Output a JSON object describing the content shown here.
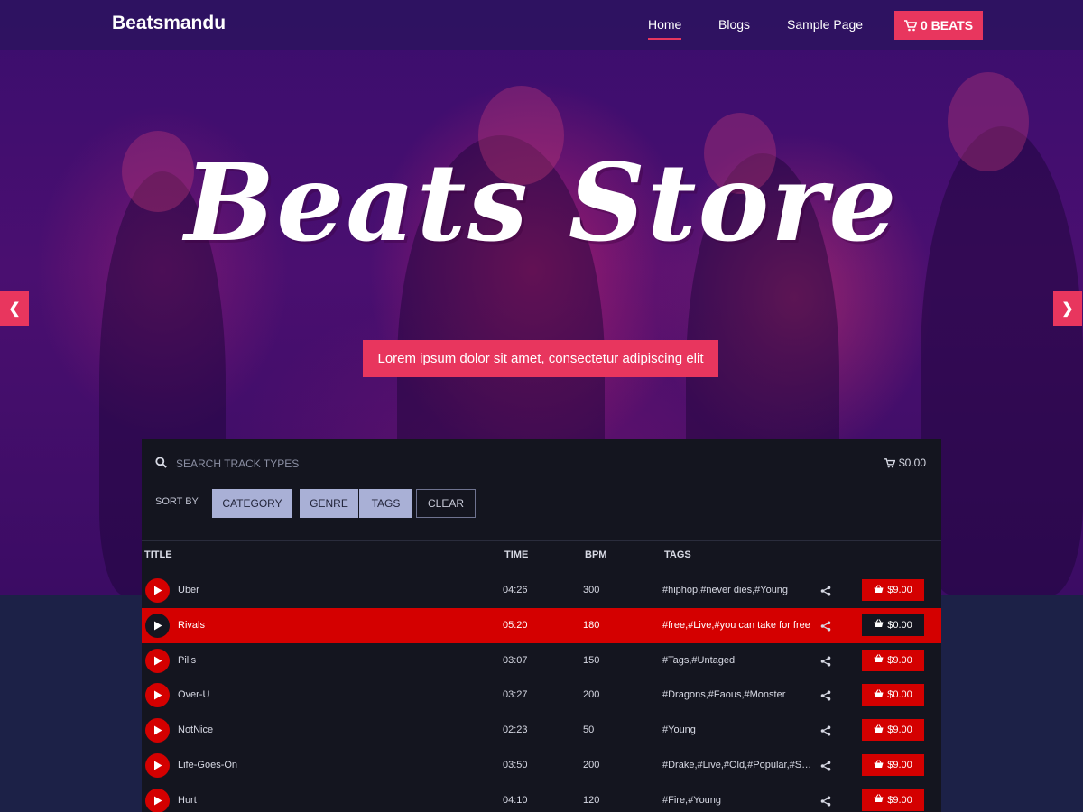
{
  "nav": {
    "brand": "Beatsmandu",
    "links": [
      "Home",
      "Blogs",
      "Sample Page"
    ],
    "cart_label": "0 BEATS"
  },
  "hero": {
    "title": "Beats Store",
    "subtitle": "Lorem ipsum dolor sit amet, consectetur adipiscing elit",
    "prev_icon": "chevron-left-icon",
    "next_icon": "chevron-right-icon"
  },
  "player": {
    "search_placeholder": "SEARCH TRACK TYPES",
    "cart_total": "$0.00",
    "sort_label": "SORT BY",
    "filters": [
      "CATEGORY",
      "GENRE",
      "TAGS"
    ],
    "clear_label": "CLEAR",
    "columns": {
      "title": "TITLE",
      "time": "TIME",
      "bpm": "BPM",
      "tags": "TAGS"
    },
    "tracks": [
      {
        "title": "Uber",
        "time": "04:26",
        "bpm": "300",
        "tags": "#hiphop,#never dies,#Young",
        "price": "$9.00"
      },
      {
        "title": "Rivals",
        "time": "05:20",
        "bpm": "180",
        "tags": "#free,#Live,#you can take for free",
        "price": "$0.00"
      },
      {
        "title": "Pills",
        "time": "03:07",
        "bpm": "150",
        "tags": "#Tags,#Untaged",
        "price": "$9.00"
      },
      {
        "title": "Over-U",
        "time": "03:27",
        "bpm": "200",
        "tags": "#Dragons,#Faous,#Monster",
        "price": "$0.00"
      },
      {
        "title": "NotNice",
        "time": "02:23",
        "bpm": "50",
        "tags": "#Young",
        "price": "$9.00"
      },
      {
        "title": "Life-Goes-On",
        "time": "03:50",
        "bpm": "200",
        "tags": "#Drake,#Live,#Old,#Popular,#Sound...",
        "price": "$9.00"
      },
      {
        "title": "Hurt",
        "time": "04:10",
        "bpm": "120",
        "tags": "#Fire,#Young",
        "price": "$9.00"
      }
    ],
    "active_track": "Rivals"
  },
  "colors": {
    "accent": "#e8365e",
    "track_red": "#d40000",
    "player_bg": "#14151f",
    "filter_bg": "#a9b0d6",
    "page_bg": "#1c2147"
  }
}
